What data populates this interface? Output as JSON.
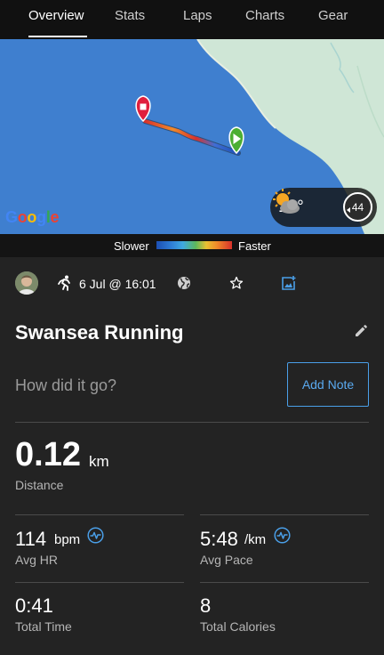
{
  "tabs": [
    {
      "label": "Overview",
      "active": true
    },
    {
      "label": "Stats",
      "active": false
    },
    {
      "label": "Laps",
      "active": false
    },
    {
      "label": "Charts",
      "active": false
    },
    {
      "label": "Gear",
      "active": false
    }
  ],
  "map": {
    "provider_logo": "Google",
    "start_marker_icon": "play-icon",
    "end_marker_icon": "stop-icon",
    "weather": {
      "temperature": "16°",
      "condition_icon": "partly-cloudy-icon",
      "wind_speed": "44"
    }
  },
  "legend": {
    "slower_label": "Slower",
    "faster_label": "Faster"
  },
  "activity": {
    "type_icon": "running-icon",
    "datetime": "6 Jul @ 16:01",
    "title": "Swansea Running",
    "feel_prompt": "How did it go?",
    "add_note_label": "Add Note"
  },
  "stats": {
    "distance": {
      "value": "0.12",
      "unit": "km",
      "label": "Distance"
    },
    "avg_hr": {
      "value": "114",
      "unit": "bpm",
      "label": "Avg HR"
    },
    "avg_pace": {
      "value": "5:48",
      "unit": "/km",
      "label": "Avg Pace"
    },
    "total_time": {
      "value": "0:41",
      "label": "Total Time"
    },
    "total_calories": {
      "value": "8",
      "label": "Total Calories"
    }
  },
  "colors": {
    "accent": "#4a9fe8",
    "background": "#232323",
    "water": "#3f7fcf",
    "land": "#cfe8d8",
    "start_marker": "#4cae33",
    "end_marker": "#e01f3d"
  }
}
